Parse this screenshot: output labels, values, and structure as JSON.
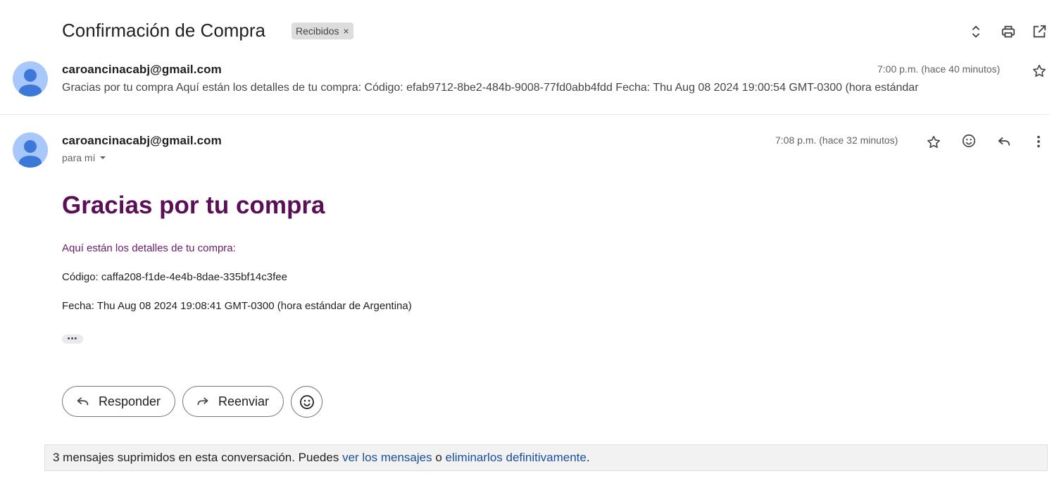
{
  "thread": {
    "subject": "Confirmación de Compra",
    "label": "Recibidos",
    "label_remove": "×",
    "toolbar_icons": [
      "expand-collapse-icon",
      "print-icon",
      "open-new-window-icon"
    ]
  },
  "collapsed_message": {
    "sender": "caroancinacabj@gmail.com",
    "time": "7:00 p.m. (hace 40 minutos)",
    "snippet": "Gracias por tu compra Aquí están los detalles de tu compra: Código: efab9712-8be2-484b-9008-77fd0abb4fdd Fecha: Thu Aug 08 2024 19:00:54 GMT-0300 (hora estándar"
  },
  "open_message": {
    "sender": "caroancinacabj@gmail.com",
    "recipient": "para mí",
    "time": "7:08 p.m. (hace 32 minutos)",
    "actions": [
      "star-icon",
      "emoji-icon",
      "reply-icon",
      "more-vert-icon"
    ],
    "body": {
      "title": "Gracias por tu compra",
      "intro": "Aquí están los detalles de tu compra:",
      "code_line": "Código: caffa208-f1de-4e4b-8dae-335bf14c3fee",
      "date_line": "Fecha: Thu Aug 08 2024 19:08:41 GMT-0300 (hora estándar de Argentina)",
      "trimmed": "•••"
    }
  },
  "reply_actions": {
    "reply": "Responder",
    "forward": "Reenviar"
  },
  "deleted_notice": {
    "prefix": "3 mensajes suprimidos en esta conversación. Puedes ",
    "link_view": "ver los mensajes",
    "middle": " o ",
    "link_delete": "eliminarlos definitivamente",
    "suffix": "."
  },
  "colors": {
    "title_purple": "#5a0f57",
    "link_blue": "#1a4fa0",
    "avatar_bg": "#a8c7fa",
    "avatar_fg": "#3c78d8"
  }
}
